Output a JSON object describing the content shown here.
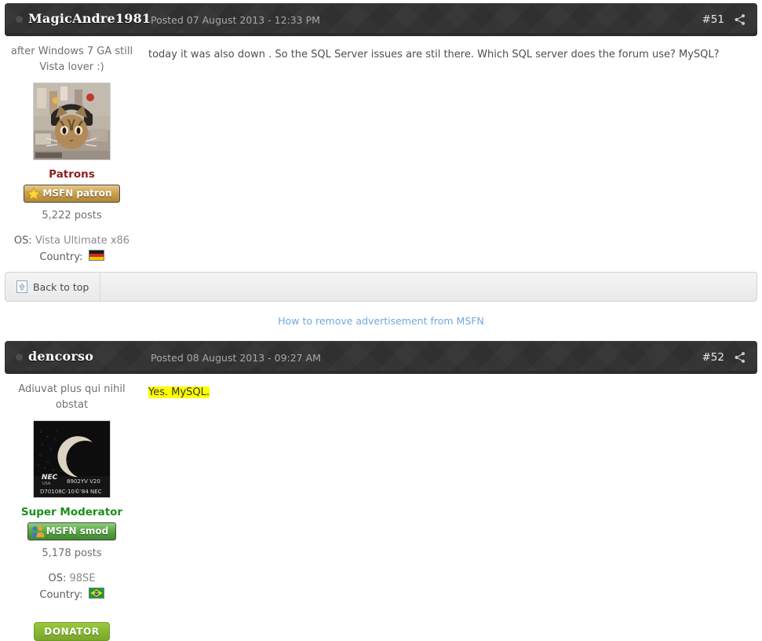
{
  "colors": {
    "header_bg": "#333333",
    "accent_link": "#6fa8dc",
    "patrons_group": "#8f2020",
    "smod_group": "#1b8f1b",
    "highlight": "#ffff00",
    "donator_green": "#97c93d"
  },
  "posts": [
    {
      "username": "MagicAndre1981",
      "date": "Posted 07 August 2013 - 12:33 PM",
      "number": "#51",
      "share_icon": "share-icon",
      "tagline": "after Windows 7 GA still Vista lover :)",
      "avatar_icon": "cat-with-headphones-avatar",
      "group": "Patrons",
      "badge_label": "MSFN patron",
      "badge_icon": "star-icon",
      "posts_count": "5,222 posts",
      "os_label": "OS:",
      "os_value": "Vista Ultimate x86",
      "country_label": "Country:",
      "country_flag": "germany-flag-icon",
      "message": "today it was also down . So the SQL Server issues are stil there. Which SQL server does the forum use? MySQL?",
      "message_highlight": "",
      "donator": ""
    },
    {
      "username": "dencorso",
      "date": "Posted 08 August 2013 - 09:27 AM",
      "number": "#52",
      "share_icon": "share-icon",
      "tagline": "Adiuvat plus qui nihil obstat",
      "avatar_icon": "nec-chip-crescent-moon-avatar",
      "group": "Super Moderator",
      "badge_label": "MSFN smod",
      "badge_icon": "two-users-icon",
      "posts_count": "5,178 posts",
      "os_label": "OS:",
      "os_value": "98SE",
      "country_label": "Country:",
      "country_flag": "brazil-flag-icon",
      "message": "",
      "message_highlight": "Yes. MySQL.",
      "donator": "DONATOR"
    }
  ],
  "back_to_top": {
    "label": "Back to top",
    "icon": "page-up-arrow-icon"
  },
  "ad_notice": {
    "link_text": "How to remove advertisement from MSFN"
  }
}
